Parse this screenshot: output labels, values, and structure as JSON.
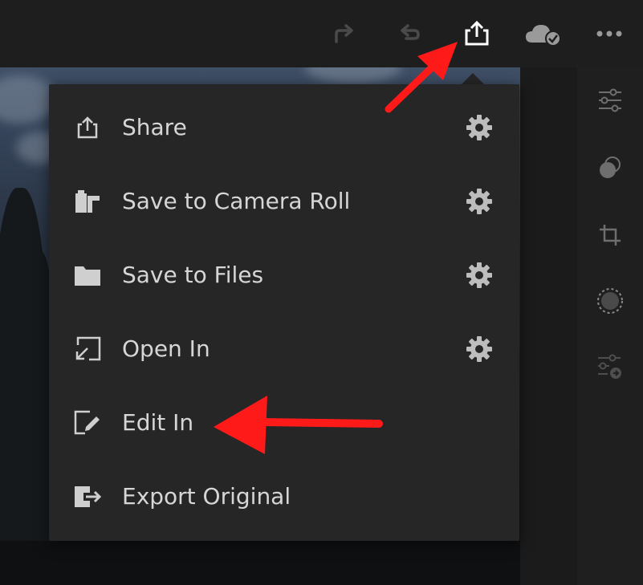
{
  "toolbar": {
    "buttons": [
      {
        "name": "redo",
        "icon": "redo-arrow-icon"
      },
      {
        "name": "undo",
        "icon": "undo-arrow-icon"
      },
      {
        "name": "share",
        "icon": "share-upload-icon"
      },
      {
        "name": "cloud-sync",
        "icon": "cloud-check-icon"
      },
      {
        "name": "more",
        "icon": "more-dots-icon"
      }
    ]
  },
  "right_panel": {
    "icons": [
      "sliders-icon",
      "presets-circles-icon",
      "crop-rotate-icon",
      "selective-edit-dotted-circle-icon",
      "healing-adjust-icon"
    ]
  },
  "menu": {
    "items": [
      {
        "label": "Share",
        "icon": "share-icon",
        "has_settings": true
      },
      {
        "label": "Save to Camera Roll",
        "icon": "camera-roll-icon",
        "has_settings": true
      },
      {
        "label": "Save to Files",
        "icon": "folder-icon",
        "has_settings": true
      },
      {
        "label": "Open In",
        "icon": "open-in-icon",
        "has_settings": true
      },
      {
        "label": "Edit In",
        "icon": "edit-in-icon",
        "has_settings": false
      },
      {
        "label": "Export Original",
        "icon": "export-original-icon",
        "has_settings": false
      }
    ]
  },
  "colors": {
    "menu_bg": "#262626",
    "menu_text": "#d6d6d6",
    "annotation_arrow": "#ff1a1a"
  }
}
